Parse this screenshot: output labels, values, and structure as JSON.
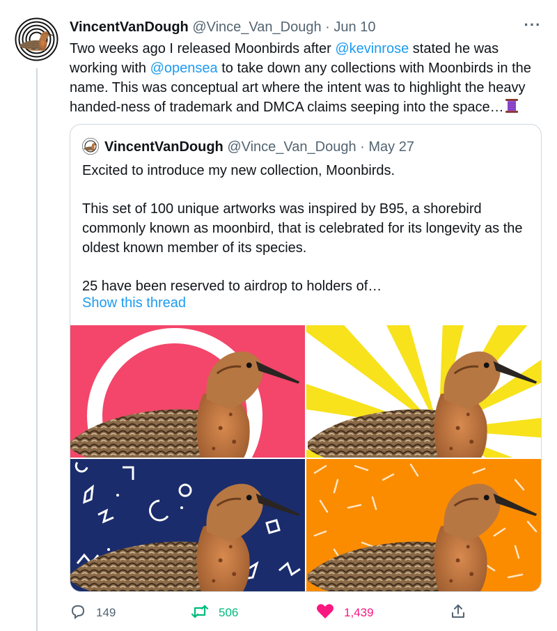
{
  "tweet": {
    "author_name": "VincentVanDough",
    "handle": "@Vince_Van_Dough",
    "separator": "·",
    "date": "Jun 10",
    "text_1": "Two weeks ago I released Moonbirds after ",
    "mention_1": "@kevinrose",
    "text_2": " stated he was working with ",
    "mention_2": "@opensea",
    "text_3": " to take down any collections with Moonbirds in the name. This was conceptual art where the intent was to highlight the heavy handed-ness of trademark and DMCA claims seeping into the space…",
    "more_label": "···"
  },
  "quote": {
    "author_name": "VincentVanDough",
    "handle": "@Vince_Van_Dough",
    "separator": "·",
    "date": "May 27",
    "para_1": "Excited to introduce my new collection, Moonbirds.",
    "para_2": "This set of 100 unique artworks was inspired by B95, a shorebird commonly known as moonbird, that is celebrated for its longevity as the oldest known member of its species.",
    "para_3": "25 have been reserved to airdrop to holders of…",
    "show_thread": "Show this thread",
    "images": [
      {
        "background": "pink-circle",
        "color": "#f3466a"
      },
      {
        "background": "yellow-sunburst",
        "color": "#f7e21c"
      },
      {
        "background": "navy-shapes",
        "color": "#1a2c6b"
      },
      {
        "background": "orange-confetti",
        "color": "#fb8c00"
      }
    ]
  },
  "actions": {
    "reply_count": "149",
    "retweet_count": "506",
    "like_count": "1,439",
    "reply_icon": "reply-icon",
    "retweet_icon": "retweet-icon",
    "like_icon": "heart-icon",
    "share_icon": "share-icon"
  },
  "colors": {
    "link": "#1d9bf0",
    "muted": "#536471",
    "retweet": "#00ba7c",
    "like": "#f91880",
    "border": "#cfd9de"
  }
}
